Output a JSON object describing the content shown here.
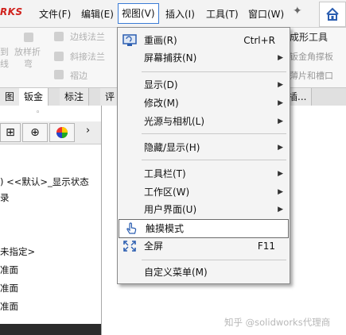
{
  "app": {
    "logo": "RKS"
  },
  "menubar": {
    "items": [
      "文件(F)",
      "编辑(E)",
      "视图(V)",
      "插入(I)",
      "工具(T)",
      "窗口(W)"
    ]
  },
  "ribbon": {
    "left_items": [
      "到",
      "线",
      "放样折",
      "弯"
    ],
    "mid_items": [
      "边线法兰",
      "斜接法兰",
      "褶边"
    ],
    "right_items": [
      "成形工具",
      "钣金角撑板",
      "薄片和槽口"
    ]
  },
  "tabs": [
    "图",
    "钣金",
    "标注",
    "评",
    "插..."
  ],
  "panel": {
    "lines": [
      ") <<默认>_显示状态 ",
      "录",
      "未指定>",
      "准面",
      "准面",
      "准面"
    ]
  },
  "menu": {
    "items": [
      {
        "label": "重画(R)",
        "shortcut": "Ctrl+R",
        "submenu": false,
        "icon": "redraw-icon"
      },
      {
        "label": "屏幕捕获(N)",
        "shortcut": "",
        "submenu": true,
        "icon": ""
      },
      {
        "label": "显示(D)",
        "shortcut": "",
        "submenu": true,
        "icon": ""
      },
      {
        "label": "修改(M)",
        "shortcut": "",
        "submenu": true,
        "icon": ""
      },
      {
        "label": "光源与相机(L)",
        "shortcut": "",
        "submenu": true,
        "icon": ""
      },
      {
        "label": "隐藏/显示(H)",
        "shortcut": "",
        "submenu": true,
        "icon": ""
      },
      {
        "label": "工具栏(T)",
        "shortcut": "",
        "submenu": true,
        "icon": ""
      },
      {
        "label": "工作区(W)",
        "shortcut": "",
        "submenu": true,
        "icon": ""
      },
      {
        "label": "用户界面(U)",
        "shortcut": "",
        "submenu": true,
        "icon": ""
      },
      {
        "label": "触摸模式",
        "shortcut": "",
        "submenu": false,
        "icon": "touch-hand-icon"
      },
      {
        "label": "全屏",
        "shortcut": "F11",
        "submenu": false,
        "icon": "fullscreen-icon"
      },
      {
        "label": "自定义菜单(M)",
        "shortcut": "",
        "submenu": false,
        "icon": ""
      }
    ]
  },
  "watermark": "知乎 @solidworks代理商",
  "colors": {
    "accent": "#3a7bd5",
    "logo": "#d0221d"
  }
}
